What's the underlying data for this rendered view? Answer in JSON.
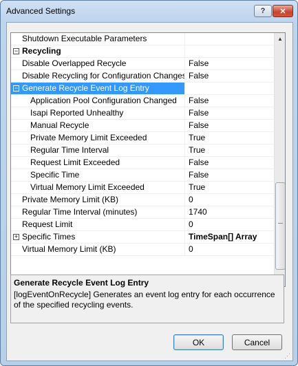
{
  "window": {
    "title": "Advanced Settings",
    "help_label": "?",
    "close_label": "✕"
  },
  "grid": {
    "rows": [
      {
        "name": "Shutdown Executable Parameters",
        "value": "",
        "level": 1,
        "kind": "property"
      },
      {
        "name": "Recycling",
        "value": "",
        "level": 0,
        "kind": "category",
        "toggle": "⊟"
      },
      {
        "name": "Disable Overlapped Recycle",
        "value": "False",
        "level": 1,
        "kind": "property"
      },
      {
        "name": "Disable Recycling for Configuration Changes",
        "value": "False",
        "level": 1,
        "kind": "property"
      },
      {
        "name": "Generate Recycle Event Log Entry",
        "value": "",
        "level": 1,
        "kind": "group",
        "toggle": "⊟",
        "selected": true
      },
      {
        "name": "Application Pool Configuration Changed",
        "value": "False",
        "level": 2,
        "kind": "property"
      },
      {
        "name": "Isapi Reported Unhealthy",
        "value": "False",
        "level": 2,
        "kind": "property"
      },
      {
        "name": "Manual Recycle",
        "value": "False",
        "level": 2,
        "kind": "property"
      },
      {
        "name": "Private Memory Limit Exceeded",
        "value": "True",
        "level": 2,
        "kind": "property"
      },
      {
        "name": "Regular Time Interval",
        "value": "True",
        "level": 2,
        "kind": "property"
      },
      {
        "name": "Request Limit Exceeded",
        "value": "False",
        "level": 2,
        "kind": "property"
      },
      {
        "name": "Specific Time",
        "value": "False",
        "level": 2,
        "kind": "property"
      },
      {
        "name": "Virtual Memory Limit Exceeded",
        "value": "True",
        "level": 2,
        "kind": "property"
      },
      {
        "name": "Private Memory Limit (KB)",
        "value": "0",
        "level": 1,
        "kind": "property"
      },
      {
        "name": "Regular Time Interval (minutes)",
        "value": "1740",
        "level": 1,
        "kind": "property"
      },
      {
        "name": "Request Limit",
        "value": "0",
        "level": 1,
        "kind": "property"
      },
      {
        "name": "Specific Times",
        "value": "TimeSpan[] Array",
        "level": 1,
        "kind": "group",
        "toggle": "⊞",
        "bold_value": true
      },
      {
        "name": "Virtual Memory Limit (KB)",
        "value": "0",
        "level": 1,
        "kind": "property"
      }
    ]
  },
  "description": {
    "title": "Generate Recycle Event Log Entry",
    "body": "[logEventOnRecycle] Generates an event log entry for each occurrence of the specified recycling events."
  },
  "buttons": {
    "ok": "OK",
    "cancel": "Cancel"
  },
  "scrollbar": {
    "up_glyph": "▲",
    "down_glyph": "▼"
  }
}
